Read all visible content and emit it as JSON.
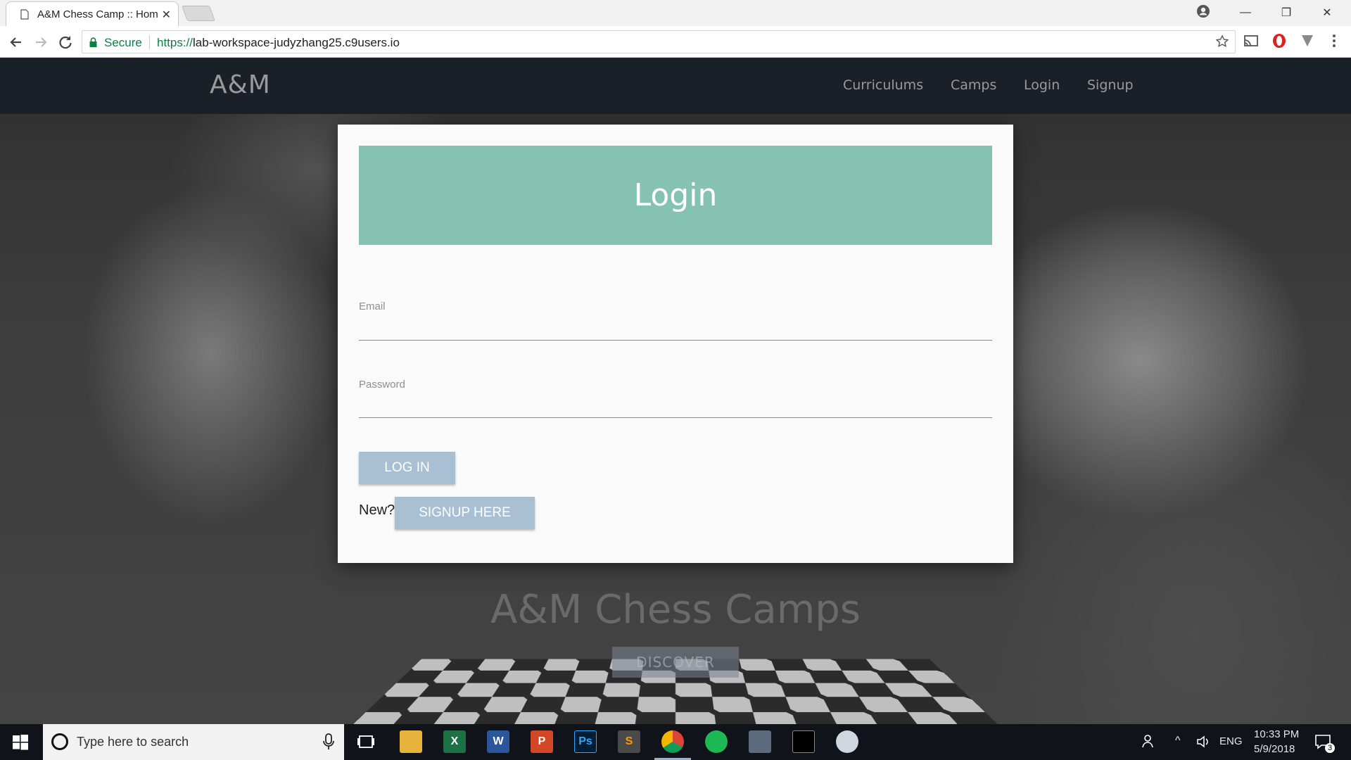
{
  "browser": {
    "tab_title": "A&M Chess Camp :: Hom",
    "secure_label": "Secure",
    "url_scheme": "https://",
    "url_rest": "lab-workspace-judyzhang25.c9users.io"
  },
  "navbar": {
    "brand": "A&M",
    "links": [
      "Curriculums",
      "Camps",
      "Login",
      "Signup"
    ]
  },
  "hero": {
    "title": "A&M Chess Camps",
    "discover_label": "DISCOVER"
  },
  "login": {
    "title": "Login",
    "email_label": "Email",
    "email_value": "",
    "password_label": "Password",
    "password_value": "",
    "login_button": "LOG IN",
    "new_text": "New?",
    "signup_button": "SIGNUP HERE"
  },
  "taskbar": {
    "search_placeholder": "Type here to search",
    "apps": [
      "file-explorer",
      "excel",
      "word",
      "powerpoint",
      "photoshop",
      "sublime-text",
      "chrome",
      "spotify",
      "snipping-tool",
      "terminal",
      "paint"
    ],
    "language": "ENG",
    "time": "10:33 PM",
    "date": "5/9/2018",
    "notification_count": "3"
  },
  "colors": {
    "navbar_bg": "#1b1f27",
    "login_header": "#86c2b0",
    "button_bg": "#a9bfd3"
  }
}
